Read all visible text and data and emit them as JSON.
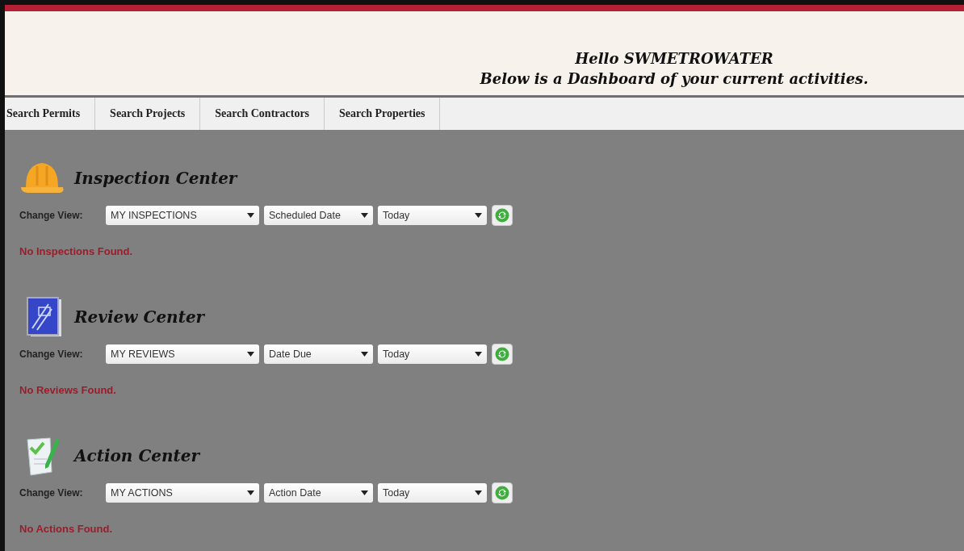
{
  "header": {
    "greeting": "Hello SWMETROWATER",
    "subtitle": "Below is a Dashboard of your current activities."
  },
  "nav": [
    {
      "label": "Search Permits"
    },
    {
      "label": "Search Projects"
    },
    {
      "label": "Search Contractors"
    },
    {
      "label": "Search Properties"
    }
  ],
  "sections": [
    {
      "kind": "inspection",
      "title": "Inspection Center",
      "view_label": "Change View:",
      "filters": [
        "MY INSPECTIONS",
        "Scheduled Date",
        "Today"
      ],
      "message": "No Inspections Found."
    },
    {
      "kind": "review",
      "title": "Review Center",
      "view_label": "Change View:",
      "filters": [
        "MY REVIEWS",
        "Date Due",
        "Today"
      ],
      "message": "No Reviews Found."
    },
    {
      "kind": "action",
      "title": "Action Center",
      "view_label": "Change View:",
      "filters": [
        "MY ACTIONS",
        "Action Date",
        "Today"
      ],
      "message": "No Actions Found."
    }
  ]
}
